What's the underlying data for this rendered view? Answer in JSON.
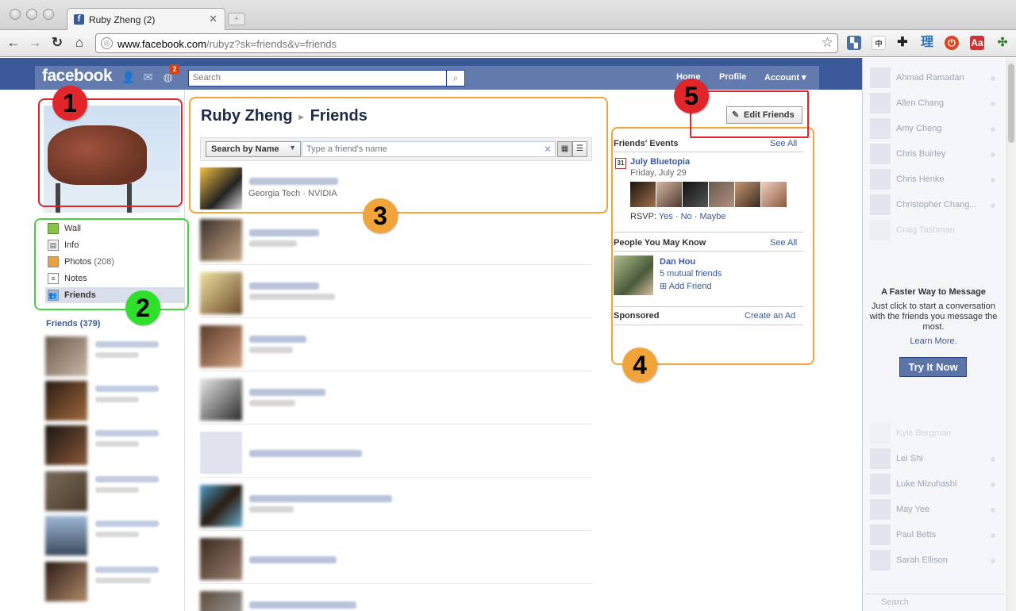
{
  "browser": {
    "tab_title": "Ruby Zheng (2)",
    "tab_favicon": "f",
    "tab_close": "✕",
    "newtab_label": "+",
    "url_host": "www.facebook.com",
    "url_path": "/rubyz?sk=friends&v=friends"
  },
  "fb": {
    "logo": "facebook",
    "notification_count": "2",
    "search_placeholder": "Search",
    "nav": {
      "home": "Home",
      "profile": "Profile",
      "account": "Account ▾"
    }
  },
  "leftnav": {
    "items": [
      {
        "label": "Wall",
        "icon": "wall-icon"
      },
      {
        "label": "Info",
        "icon": "info-icon"
      },
      {
        "label": "Photos",
        "count": "(208)",
        "icon": "photos-icon"
      },
      {
        "label": "Notes",
        "icon": "notes-icon"
      },
      {
        "label": "Friends",
        "icon": "friends-icon"
      }
    ],
    "friends_count": "Friends (379)"
  },
  "main": {
    "owner": "Ruby Zheng",
    "separator": "▸",
    "section": "Friends",
    "sort_label": "Search by Name",
    "friend_search_placeholder": "Type a friend's name",
    "first_friend_network": "Georgia Tech · NVIDIA"
  },
  "right": {
    "edit_friends": "Edit Friends",
    "events_title": "Friends' Events",
    "see_all": "See All",
    "event_name": "July Bluetopia",
    "event_date": "Friday, July 29",
    "event_cal_day": "31",
    "rsvp_label": "RSVP:",
    "rsvp_yes": "Yes",
    "rsvp_no": "No",
    "rsvp_maybe": "Maybe",
    "pymk_title": "People You May Know",
    "pymk_name": "Dan Hou",
    "pymk_mutual": "5 mutual friends",
    "pymk_add": "Add Friend",
    "sponsored_title": "Sponsored",
    "create_ad": "Create an Ad"
  },
  "annotations": [
    "1",
    "2",
    "3",
    "4",
    "5"
  ],
  "chat": {
    "top_names": [
      "Ahmad Ramadan",
      "Allen Chang",
      "Amy Cheng",
      "Chris Buirley",
      "Chris Henke",
      "Christopher Chang...",
      "Craig Tashman"
    ],
    "bottom_names": [
      "Kyle Bergman",
      "Lei Shi",
      "Luke Mizuhashi",
      "May Yee",
      "Paul Betts",
      "Sarah Ellison"
    ],
    "promo_title": "A Faster Way to Message",
    "promo_body": "Just click to start a conversation with the friends you message the most.",
    "learn_more": "Learn More.",
    "try_button": "Try It Now",
    "search_placeholder": "Search"
  },
  "colors": {
    "fb_blue": "#3b5998",
    "red": "#e0262a",
    "green": "#2ee02a",
    "orange": "#f0a43a"
  }
}
